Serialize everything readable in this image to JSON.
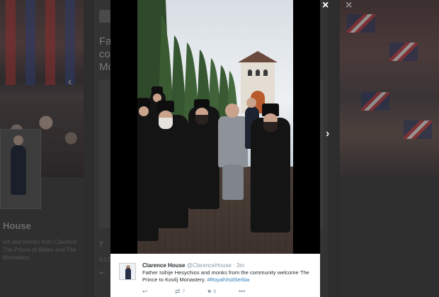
{
  "overlay": {
    "close_icon": "×",
    "close_icon_bg": "×",
    "prev_icon": "‹",
    "next_icon": "›"
  },
  "background": {
    "account_name_partial": "House",
    "title_partial": "Fa co Mo",
    "caption_partial": "ioh and monks from Clarence The Prince of Wales and The Monastery",
    "count": "7",
    "small_text": "5:17",
    "reply_icon": "↩"
  },
  "tweet": {
    "name": "Clarence House",
    "handle": "@ClarenceHouse",
    "separator": "·",
    "time": "3m",
    "text_main": "Father Isihije Hesychios and monks from the community welcome The Prince to Kovilj Monastery.",
    "hashtag": "#RoyalVisitSerbia",
    "actions": {
      "reply_icon": "↩",
      "retweet_icon": "⇄",
      "retweet_count": "7",
      "like_icon": "♥",
      "like_count": "9",
      "more_icon": "•••"
    }
  },
  "colors": {
    "link": "#2b7bb9",
    "muted": "#8899a6",
    "text": "#292f33"
  }
}
